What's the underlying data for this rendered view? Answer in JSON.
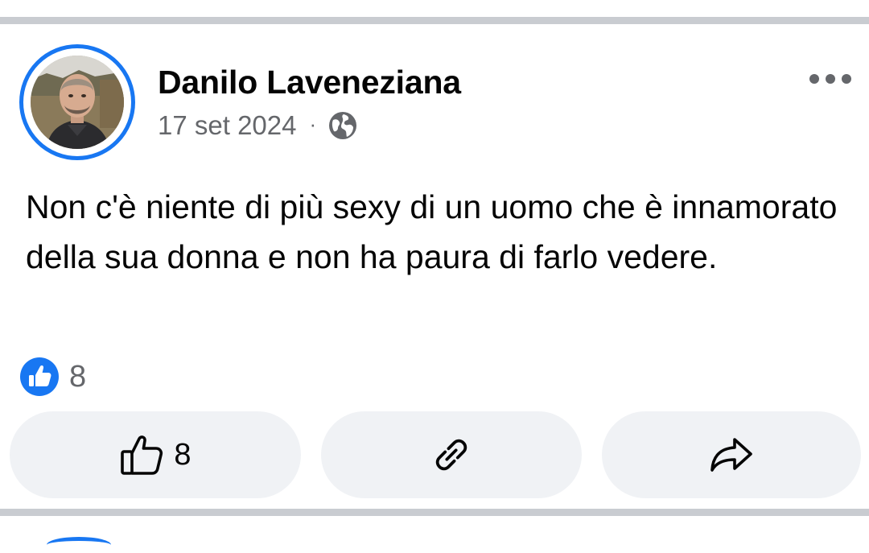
{
  "post": {
    "author": "Danilo Laveneziana",
    "date": "17 set 2024",
    "separator": "·",
    "privacy_icon": "globe-icon",
    "text": "Non c'è niente di più sexy di un uomo che è innamorato della sua donna e non ha paura di farlo vedere.",
    "reactions": {
      "icon": "like-reaction-icon",
      "count": "8"
    },
    "actions": {
      "like_icon": "thumbs-up-outline-icon",
      "like_count": "8",
      "link_icon": "link-icon",
      "share_icon": "share-arrow-icon"
    },
    "more_icon": "ellipsis-icon"
  },
  "colors": {
    "accent": "#1877f2",
    "secondary_text": "#65676b",
    "button_bg": "#f0f2f5",
    "divider": "#c9ccd1"
  }
}
